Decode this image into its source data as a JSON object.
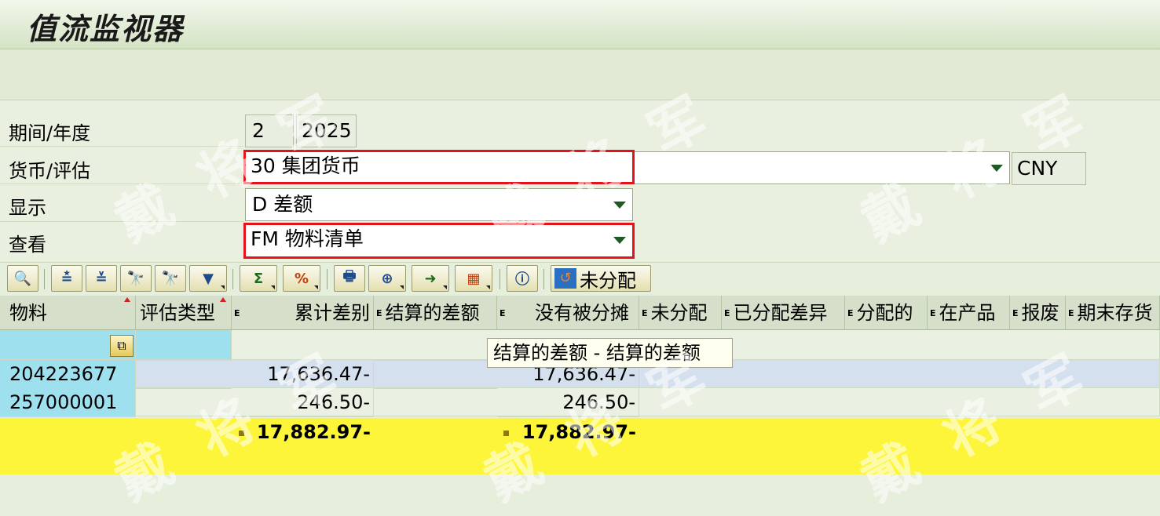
{
  "title": "值流监视器",
  "selection": {
    "period_label": "期间/年度",
    "period": "2",
    "year": "2025",
    "currency_label": "货币/评估",
    "currency_value": "30 集团货币",
    "currency_code": "CNY",
    "display_label": "显示",
    "display_value": "D 差额",
    "view_label": "查看",
    "view_value": "FM 物料清单"
  },
  "toolbar": {
    "buttons": [
      "zoom-detail",
      "sort-ascending",
      "filter-rows",
      "find",
      "find-next",
      "set-filter",
      "sum",
      "subtotals",
      "print",
      "views",
      "export",
      "layout",
      "info"
    ],
    "unassigned_label": "未分配"
  },
  "grid": {
    "columns": [
      "物料",
      "评估类型",
      "累计差别",
      "结算的差额",
      "没有被分摊",
      "未分配",
      "已分配差异",
      "分配的",
      "在产品",
      "报废",
      "期末存货"
    ],
    "rows": [
      {
        "material": "204223677",
        "cumulative": "17,636.47-",
        "not_allocated": "17,636.47-"
      },
      {
        "material": "257000001",
        "cumulative": "246.50-",
        "not_allocated": "246.50-"
      }
    ],
    "totals": {
      "cumulative": "17,882.97-",
      "not_allocated": "17,882.97-"
    }
  },
  "tooltip": "结算的差额 - 结算的差额",
  "watermark": "戴将军"
}
